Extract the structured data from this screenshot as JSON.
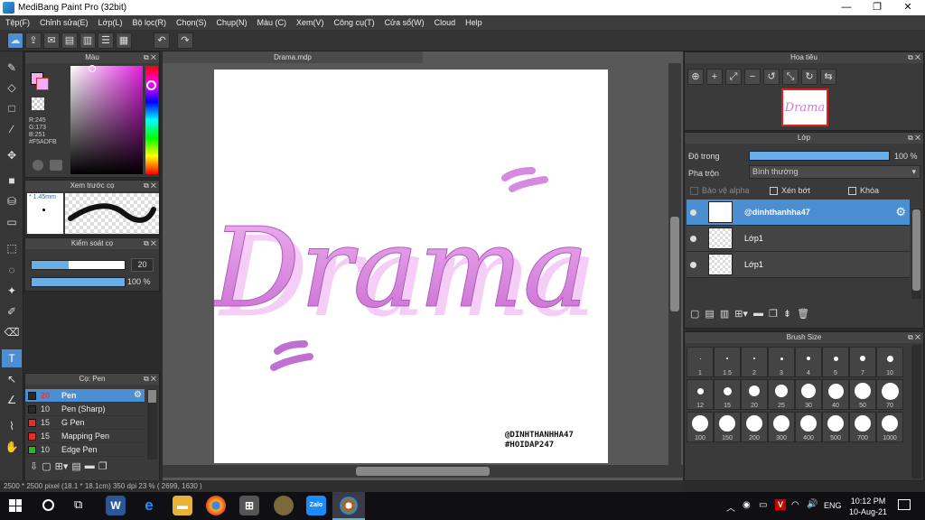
{
  "window": {
    "title": "MediBang Paint Pro (32bit)",
    "minimize": "—",
    "maximize": "❐",
    "close": "✕"
  },
  "menu": [
    "Tệp(F)",
    "Chỉnh sửa(E)",
    "Lớp(L)",
    "Bộ lọc(R)",
    "Chọn(S)",
    "Chụp(N)",
    "Màu (C)",
    "Xem(V)",
    "Công cụ(T)",
    "Cửa sổ(W)",
    "Cloud",
    "Help"
  ],
  "color_panel": {
    "title": "Màu",
    "r": "R:245",
    "g": "G:173",
    "b": "B:251",
    "hex": "#F5ADFB",
    "accent": "#F5ADFB"
  },
  "brush_preview": {
    "title": "Xem trước cọ",
    "size": "* 1.45mm"
  },
  "brush_control": {
    "title": "Kiểm soát cọ",
    "size_value": "20",
    "opacity_value": "100 %",
    "size_fraction": 0.4,
    "opacity_fraction": 1.0
  },
  "brush_list": {
    "title": "Cọ: Pen",
    "items": [
      {
        "size": "20",
        "name": "Pen",
        "color": "#2a2a2a",
        "selected": true
      },
      {
        "size": "10",
        "name": "Pen (Sharp)",
        "color": "#2a2a2a"
      },
      {
        "size": "15",
        "name": "G Pen",
        "color": "#e03030"
      },
      {
        "size": "15",
        "name": "Mapping Pen",
        "color": "#e03030"
      },
      {
        "size": "10",
        "name": "Edge Pen",
        "color": "#30b030"
      }
    ]
  },
  "document": {
    "tab": "Drama.mdp",
    "title_art": "Drama",
    "watermark_line1": "@DINHTHANHHA47",
    "watermark_line2": "#HOIDAP247"
  },
  "status": {
    "text": "2500 * 2500 pixel   (18.1 * 18.1cm)   350 dpi   23 %   ( 2699, 1630 )"
  },
  "navigator": {
    "title": "Hoa tiêu"
  },
  "layers": {
    "title": "Lớp",
    "opacity_label": "Độ trong",
    "opacity_value": "100 %",
    "blend_label": "Pha trộn",
    "blend_value": "Bình thường",
    "protect_alpha": "Bảo vệ alpha",
    "clipping": "Xén bớt",
    "lock": "Khóa",
    "items": [
      {
        "name": "@dinhthanhha47",
        "selected": true
      },
      {
        "name": "Lớp1"
      },
      {
        "name": "Lớp1"
      }
    ]
  },
  "brush_size": {
    "title": "Brush Size",
    "sizes": [
      "1",
      "1.5",
      "2",
      "3",
      "4",
      "5",
      "7",
      "10",
      "12",
      "15",
      "20",
      "25",
      "30",
      "40",
      "50",
      "70",
      "100",
      "150",
      "200",
      "300",
      "400",
      "500",
      "700",
      "1000"
    ]
  },
  "taskbar": {
    "lang": "ENG",
    "time": "10:12 PM",
    "date": "10-Aug-21"
  }
}
